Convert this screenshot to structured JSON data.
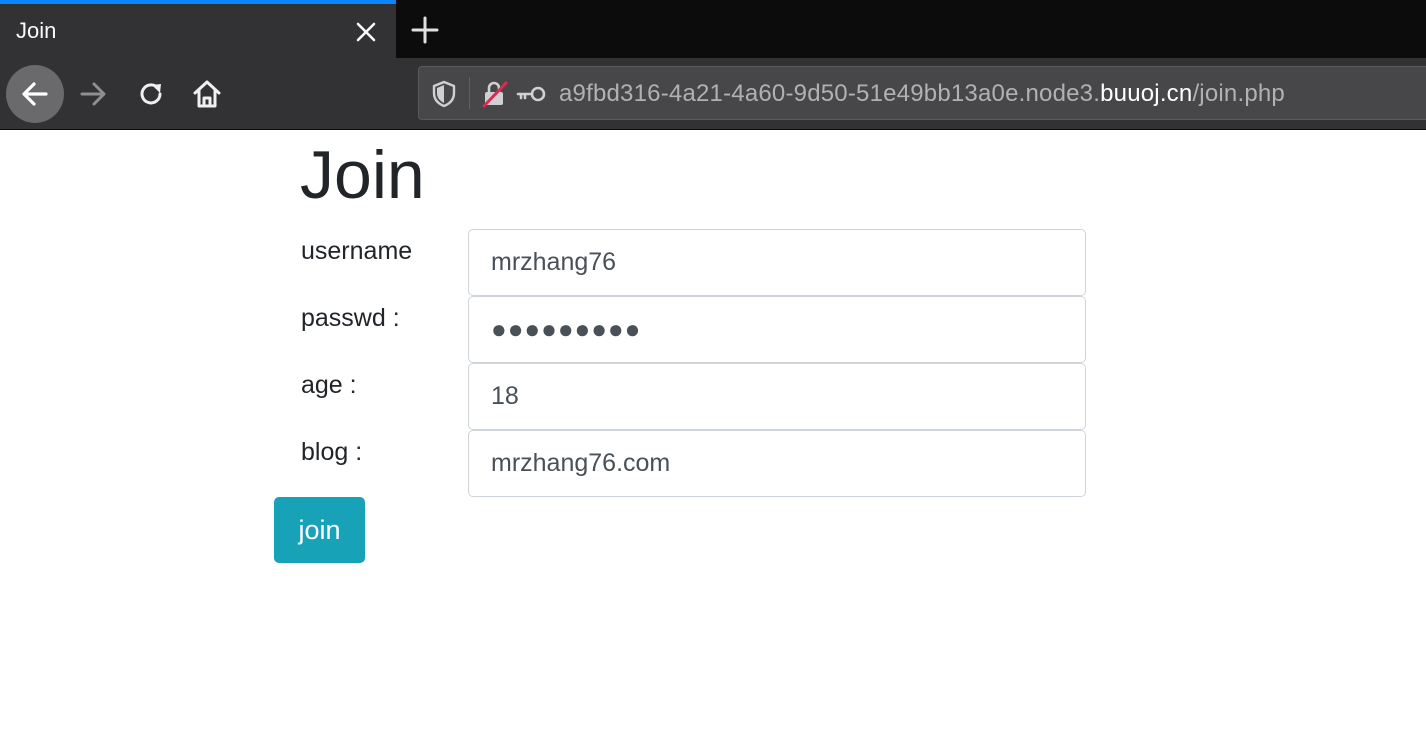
{
  "browser": {
    "tab": {
      "title": "Join"
    },
    "url": {
      "prefix": "a9fbd316-4a21-4a60-9d50-51e49bb13a0e.node3.",
      "host": "buuoj.cn",
      "path": "/join.php"
    },
    "accent_color": "#0a84ff",
    "icons": [
      "close-icon",
      "plus-icon",
      "back-arrow-icon",
      "forward-arrow-icon",
      "reload-icon",
      "home-icon",
      "shield-icon",
      "insecure-lock-icon",
      "key-icon"
    ]
  },
  "page": {
    "title": "Join",
    "fields": {
      "username": {
        "label": "username",
        "value": "mrzhang76"
      },
      "passwd": {
        "label": "passwd :",
        "value": "●●●●●●●●●"
      },
      "age": {
        "label": "age :",
        "value": "18"
      },
      "blog": {
        "label": "blog :",
        "value": "mrzhang76.com"
      }
    },
    "submit_label": "join",
    "submit_color": "#17a2b8"
  }
}
